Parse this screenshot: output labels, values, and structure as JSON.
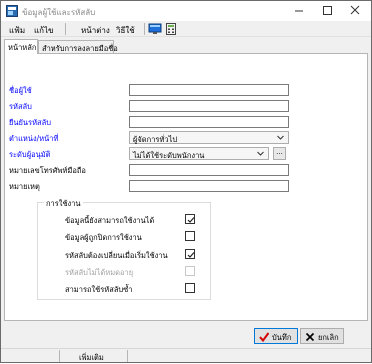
{
  "window": {
    "title": "ข้อมูลผู้ใช้และรหัสลับ"
  },
  "menu": {
    "items": [
      "แฟ้ม",
      "แก้ไข",
      "หน้าต่าง",
      "วิธีใช้"
    ]
  },
  "tabs": [
    "หน้าหลัก",
    "สำหรับการลงลายมือชื่อ"
  ],
  "form": {
    "user_label": "ชื่อผู้ใช้",
    "user_value": "",
    "password_label": "รหัสลับ",
    "password_value": "",
    "confirm_label": "ยืนยันรหัสลับ",
    "confirm_value": "",
    "position_label": "ตำแหน่ง/หน้าที่",
    "position_value": "ผู้จัดการทั่วไป",
    "security_label": "ระดับผู้อนุมัติ",
    "security_value": "ไม่ได้ใช้ระดับพนักงาน",
    "dots_label": "...",
    "phone_label": "หมายเลขโทรศัพท์มือถือ",
    "phone_value": "",
    "note_label": "หมายเหตุ",
    "note_value": ""
  },
  "usage": {
    "title": "การใช้งาน",
    "options": [
      {
        "label": "ข้อมูลนี้ยังสามารถใช้งานได้",
        "checked": true,
        "disabled": false
      },
      {
        "label": "ข้อมูลผู้ถูกปิดการใช้งาน",
        "checked": false,
        "disabled": false
      },
      {
        "label": "รหัสลับต้องเปลี่ยนเมื่อเริ่มใช้งาน",
        "checked": true,
        "disabled": false
      },
      {
        "label": "รหัสลับไม่ได้หมดอายุ",
        "checked": false,
        "disabled": true
      },
      {
        "label": "สามารถใช้รหัสลับซ้ำ",
        "checked": false,
        "disabled": false
      }
    ]
  },
  "buttons": {
    "ok": "บันทึก",
    "cancel": "ยกเลิก"
  },
  "status": {
    "mode": "เพิ่มเติม"
  },
  "colors": {
    "required_label": "#0000ff",
    "ok_icon": "#d40000",
    "cancel_icon": "#000000"
  }
}
